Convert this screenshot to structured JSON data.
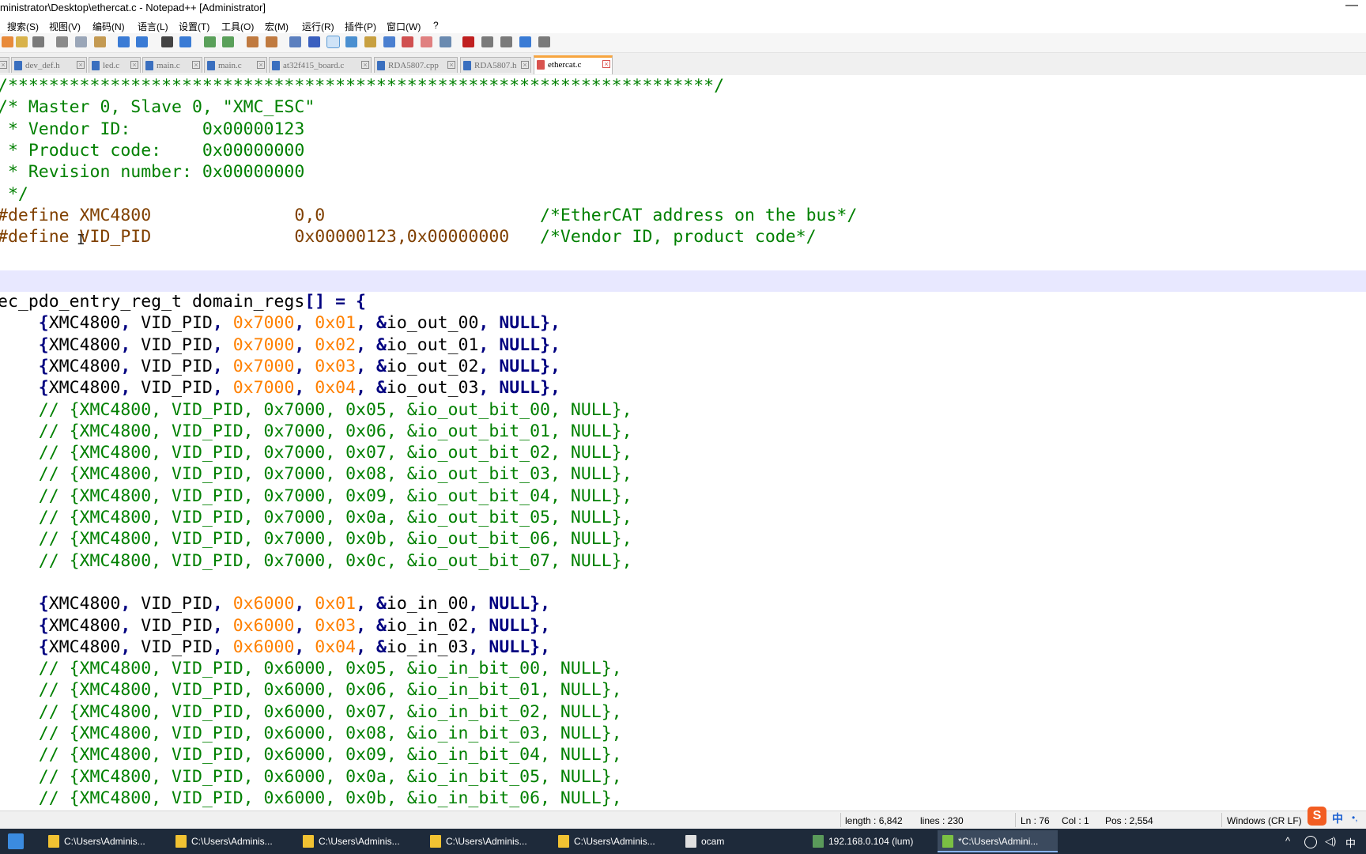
{
  "window": {
    "title": "ministrator\\Desktop\\ethercat.c - Notepad++ [Administrator]",
    "minimize_glyph": "—"
  },
  "menu": [
    "搜索(S)",
    "视图(V)",
    "编码(N)",
    "语言(L)",
    "设置(T)",
    "工具(O)",
    "宏(M)",
    "运行(R)",
    "插件(P)",
    "窗口(W)",
    "?"
  ],
  "toolbar_icons": [
    "new-file-icon",
    "open-file-icon",
    "print-icon",
    "cut-icon",
    "copy-icon",
    "paste-icon",
    "undo-icon",
    "redo-icon",
    "find-icon",
    "replace-icon",
    "zoom-in-icon",
    "zoom-out-icon",
    "sync-v-icon",
    "sync-h-icon",
    "word-wrap-icon",
    "show-all-chars-icon",
    "indent-guide-icon",
    "doc-map-icon",
    "function-list-icon",
    "folder-workspace-icon",
    "monitoring-icon",
    "record-macro-icon",
    "stop-macro-icon",
    "play-macro-icon",
    "run-macro-multiple-icon",
    "save-macro-icon"
  ],
  "tabs": [
    {
      "label": "dev_def.h",
      "active": false
    },
    {
      "label": "led.c",
      "active": false
    },
    {
      "label": "main.c",
      "active": false
    },
    {
      "label": "main.c",
      "active": false
    },
    {
      "label": "at32f415_board.c",
      "active": false
    },
    {
      "label": "RDA5807.cpp",
      "active": false
    },
    {
      "label": "RDA5807.h",
      "active": false
    },
    {
      "label": "ethercat.c",
      "active": true
    }
  ],
  "code_lines": [
    {
      "t": 0,
      "spans": [
        {
          "c": "c-comment",
          "s": "/*********************************************************************/"
        }
      ]
    },
    {
      "t": 1,
      "spans": [
        {
          "c": "c-comment",
          "s": "/* Master 0, Slave 0, \"XMC_ESC\""
        }
      ]
    },
    {
      "t": 2,
      "spans": [
        {
          "c": "c-comment",
          "s": " * Vendor ID:       0x00000123"
        }
      ]
    },
    {
      "t": 3,
      "spans": [
        {
          "c": "c-comment",
          "s": " * Product code:    0x00000000"
        }
      ]
    },
    {
      "t": 4,
      "spans": [
        {
          "c": "c-comment",
          "s": " * Revision number: 0x00000000"
        }
      ]
    },
    {
      "t": 5,
      "spans": [
        {
          "c": "c-comment",
          "s": " */"
        }
      ]
    },
    {
      "t": 6,
      "spans": [
        {
          "c": "c-pre",
          "s": "#define XMC4800              0,0                     "
        },
        {
          "c": "c-comment",
          "s": "/*EtherCAT address on the bus*/"
        }
      ]
    },
    {
      "t": 7,
      "spans": [
        {
          "c": "c-pre",
          "s": "#define VID_PID              0x00000123,0x00000000   "
        },
        {
          "c": "c-comment",
          "s": "/*Vendor ID, product code*/"
        }
      ]
    },
    {
      "t": 8,
      "spans": []
    },
    {
      "t": 9,
      "spans": []
    },
    {
      "t": 10,
      "spans": [
        {
          "c": "c-def",
          "s": "ec_pdo_entry_reg_t domain_regs"
        },
        {
          "c": "c-punc",
          "s": "[] = {"
        }
      ]
    },
    {
      "t": 11,
      "spans": [
        {
          "c": "c-punc",
          "s": "    {"
        },
        {
          "c": "c-def",
          "s": "XMC4800"
        },
        {
          "c": "c-punc",
          "s": ", "
        },
        {
          "c": "c-def",
          "s": "VID_PID"
        },
        {
          "c": "c-punc",
          "s": ", "
        },
        {
          "c": "c-hex",
          "s": "0x7000"
        },
        {
          "c": "c-punc",
          "s": ", "
        },
        {
          "c": "c-hex",
          "s": "0x01"
        },
        {
          "c": "c-punc",
          "s": ", &"
        },
        {
          "c": "c-def",
          "s": "io_out_00"
        },
        {
          "c": "c-punc",
          "s": ", "
        },
        {
          "c": "c-null",
          "s": "NULL"
        },
        {
          "c": "c-punc",
          "s": "},"
        }
      ]
    },
    {
      "t": 12,
      "spans": [
        {
          "c": "c-punc",
          "s": "    {"
        },
        {
          "c": "c-def",
          "s": "XMC4800"
        },
        {
          "c": "c-punc",
          "s": ", "
        },
        {
          "c": "c-def",
          "s": "VID_PID"
        },
        {
          "c": "c-punc",
          "s": ", "
        },
        {
          "c": "c-hex",
          "s": "0x7000"
        },
        {
          "c": "c-punc",
          "s": ", "
        },
        {
          "c": "c-hex",
          "s": "0x02"
        },
        {
          "c": "c-punc",
          "s": ", &"
        },
        {
          "c": "c-def",
          "s": "io_out_01"
        },
        {
          "c": "c-punc",
          "s": ", "
        },
        {
          "c": "c-null",
          "s": "NULL"
        },
        {
          "c": "c-punc",
          "s": "},"
        }
      ]
    },
    {
      "t": 13,
      "spans": [
        {
          "c": "c-punc",
          "s": "    {"
        },
        {
          "c": "c-def",
          "s": "XMC4800"
        },
        {
          "c": "c-punc",
          "s": ", "
        },
        {
          "c": "c-def",
          "s": "VID_PID"
        },
        {
          "c": "c-punc",
          "s": ", "
        },
        {
          "c": "c-hex",
          "s": "0x7000"
        },
        {
          "c": "c-punc",
          "s": ", "
        },
        {
          "c": "c-hex",
          "s": "0x03"
        },
        {
          "c": "c-punc",
          "s": ", &"
        },
        {
          "c": "c-def",
          "s": "io_out_02"
        },
        {
          "c": "c-punc",
          "s": ", "
        },
        {
          "c": "c-null",
          "s": "NULL"
        },
        {
          "c": "c-punc",
          "s": "},"
        }
      ]
    },
    {
      "t": 14,
      "spans": [
        {
          "c": "c-punc",
          "s": "    {"
        },
        {
          "c": "c-def",
          "s": "XMC4800"
        },
        {
          "c": "c-punc",
          "s": ", "
        },
        {
          "c": "c-def",
          "s": "VID_PID"
        },
        {
          "c": "c-punc",
          "s": ", "
        },
        {
          "c": "c-hex",
          "s": "0x7000"
        },
        {
          "c": "c-punc",
          "s": ", "
        },
        {
          "c": "c-hex",
          "s": "0x04"
        },
        {
          "c": "c-punc",
          "s": ", &"
        },
        {
          "c": "c-def",
          "s": "io_out_03"
        },
        {
          "c": "c-punc",
          "s": ", "
        },
        {
          "c": "c-null",
          "s": "NULL"
        },
        {
          "c": "c-punc",
          "s": "},"
        }
      ]
    },
    {
      "t": 15,
      "spans": [
        {
          "c": "c-comment",
          "s": "    // {XMC4800, VID_PID, 0x7000, 0x05, &io_out_bit_00, NULL},"
        }
      ]
    },
    {
      "t": 16,
      "spans": [
        {
          "c": "c-comment",
          "s": "    // {XMC4800, VID_PID, 0x7000, 0x06, &io_out_bit_01, NULL},"
        }
      ]
    },
    {
      "t": 17,
      "spans": [
        {
          "c": "c-comment",
          "s": "    // {XMC4800, VID_PID, 0x7000, 0x07, &io_out_bit_02, NULL},"
        }
      ]
    },
    {
      "t": 18,
      "spans": [
        {
          "c": "c-comment",
          "s": "    // {XMC4800, VID_PID, 0x7000, 0x08, &io_out_bit_03, NULL},"
        }
      ]
    },
    {
      "t": 19,
      "spans": [
        {
          "c": "c-comment",
          "s": "    // {XMC4800, VID_PID, 0x7000, 0x09, &io_out_bit_04, NULL},"
        }
      ]
    },
    {
      "t": 20,
      "spans": [
        {
          "c": "c-comment",
          "s": "    // {XMC4800, VID_PID, 0x7000, 0x0a, &io_out_bit_05, NULL},"
        }
      ]
    },
    {
      "t": 21,
      "spans": [
        {
          "c": "c-comment",
          "s": "    // {XMC4800, VID_PID, 0x7000, 0x0b, &io_out_bit_06, NULL},"
        }
      ]
    },
    {
      "t": 22,
      "spans": [
        {
          "c": "c-comment",
          "s": "    // {XMC4800, VID_PID, 0x7000, 0x0c, &io_out_bit_07, NULL},"
        }
      ]
    },
    {
      "t": 23,
      "spans": []
    },
    {
      "t": 24,
      "spans": [
        {
          "c": "c-punc",
          "s": "    {"
        },
        {
          "c": "c-def",
          "s": "XMC4800"
        },
        {
          "c": "c-punc",
          "s": ", "
        },
        {
          "c": "c-def",
          "s": "VID_PID"
        },
        {
          "c": "c-punc",
          "s": ", "
        },
        {
          "c": "c-hex",
          "s": "0x6000"
        },
        {
          "c": "c-punc",
          "s": ", "
        },
        {
          "c": "c-hex",
          "s": "0x01"
        },
        {
          "c": "c-punc",
          "s": ", &"
        },
        {
          "c": "c-def",
          "s": "io_in_00"
        },
        {
          "c": "c-punc",
          "s": ", "
        },
        {
          "c": "c-null",
          "s": "NULL"
        },
        {
          "c": "c-punc",
          "s": "},"
        }
      ]
    },
    {
      "t": 25,
      "spans": [
        {
          "c": "c-punc",
          "s": "    {"
        },
        {
          "c": "c-def",
          "s": "XMC4800"
        },
        {
          "c": "c-punc",
          "s": ", "
        },
        {
          "c": "c-def",
          "s": "VID_PID"
        },
        {
          "c": "c-punc",
          "s": ", "
        },
        {
          "c": "c-hex",
          "s": "0x6000"
        },
        {
          "c": "c-punc",
          "s": ", "
        },
        {
          "c": "c-hex",
          "s": "0x03"
        },
        {
          "c": "c-punc",
          "s": ", &"
        },
        {
          "c": "c-def",
          "s": "io_in_02"
        },
        {
          "c": "c-punc",
          "s": ", "
        },
        {
          "c": "c-null",
          "s": "NULL"
        },
        {
          "c": "c-punc",
          "s": "},"
        }
      ]
    },
    {
      "t": 26,
      "spans": [
        {
          "c": "c-punc",
          "s": "    {"
        },
        {
          "c": "c-def",
          "s": "XMC4800"
        },
        {
          "c": "c-punc",
          "s": ", "
        },
        {
          "c": "c-def",
          "s": "VID_PID"
        },
        {
          "c": "c-punc",
          "s": ", "
        },
        {
          "c": "c-hex",
          "s": "0x6000"
        },
        {
          "c": "c-punc",
          "s": ", "
        },
        {
          "c": "c-hex",
          "s": "0x04"
        },
        {
          "c": "c-punc",
          "s": ", &"
        },
        {
          "c": "c-def",
          "s": "io_in_03"
        },
        {
          "c": "c-punc",
          "s": ", "
        },
        {
          "c": "c-null",
          "s": "NULL"
        },
        {
          "c": "c-punc",
          "s": "},"
        }
      ]
    },
    {
      "t": 27,
      "spans": [
        {
          "c": "c-comment",
          "s": "    // {XMC4800, VID_PID, 0x6000, 0x05, &io_in_bit_00, NULL},"
        }
      ]
    },
    {
      "t": 28,
      "spans": [
        {
          "c": "c-comment",
          "s": "    // {XMC4800, VID_PID, 0x6000, 0x06, &io_in_bit_01, NULL},"
        }
      ]
    },
    {
      "t": 29,
      "spans": [
        {
          "c": "c-comment",
          "s": "    // {XMC4800, VID_PID, 0x6000, 0x07, &io_in_bit_02, NULL},"
        }
      ]
    },
    {
      "t": 30,
      "spans": [
        {
          "c": "c-comment",
          "s": "    // {XMC4800, VID_PID, 0x6000, 0x08, &io_in_bit_03, NULL},"
        }
      ]
    },
    {
      "t": 31,
      "spans": [
        {
          "c": "c-comment",
          "s": "    // {XMC4800, VID_PID, 0x6000, 0x09, &io_in_bit_04, NULL},"
        }
      ]
    },
    {
      "t": 32,
      "spans": [
        {
          "c": "c-comment",
          "s": "    // {XMC4800, VID_PID, 0x6000, 0x0a, &io_in_bit_05, NULL},"
        }
      ]
    },
    {
      "t": 33,
      "spans": [
        {
          "c": "c-comment",
          "s": "    // {XMC4800, VID_PID, 0x6000, 0x0b, &io_in_bit_06, NULL},"
        }
      ]
    }
  ],
  "status": {
    "length": "length : 6,842",
    "lines": "lines : 230",
    "ln": "Ln : 76",
    "col": "Col : 1",
    "pos": "Pos : 2,554",
    "eol": "Windows (CR LF)"
  },
  "ime": {
    "mode": "中",
    "dots": "•,",
    "sogou_glyph": "S"
  },
  "taskbar": {
    "items": [
      {
        "label": "C:\\Users\\Adminis...",
        "icon": "folder-icon"
      },
      {
        "label": "C:\\Users\\Adminis...",
        "icon": "folder-icon"
      },
      {
        "label": "C:\\Users\\Adminis...",
        "icon": "folder-icon"
      },
      {
        "label": "C:\\Users\\Adminis...",
        "icon": "folder-icon"
      },
      {
        "label": "C:\\Users\\Adminis...",
        "icon": "folder-icon"
      },
      {
        "label": "ocam",
        "icon": "ocam-icon"
      },
      {
        "label": "192.168.0.104 (lum)",
        "icon": "remote-desktop-icon"
      },
      {
        "label": "*C:\\Users\\Admini...",
        "icon": "notepadpp-icon",
        "active": true
      }
    ],
    "tray": {
      "chevron": "^",
      "ime": "中"
    }
  },
  "colors": {
    "comment": "#008000",
    "preprocessor": "#804000",
    "hex": "#ff8000",
    "keyword": "#000080",
    "current_line": "#e8e8ff",
    "active_tab_accent": "#f7a53f"
  }
}
